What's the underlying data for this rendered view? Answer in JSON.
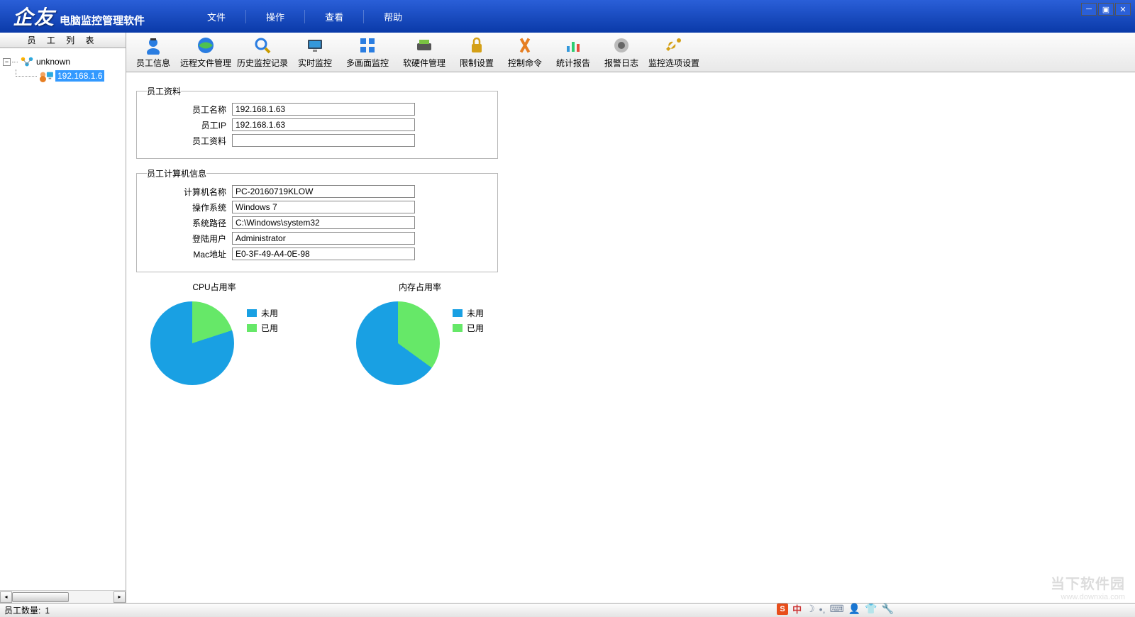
{
  "app": {
    "logo": "企友",
    "subtitle": "电脑监控管理软件"
  },
  "menu": [
    "文件",
    "操作",
    "查看",
    "帮助"
  ],
  "sidebar": {
    "title": "员 工 列 表",
    "root": "unknown",
    "child": "192.168.1.6"
  },
  "toolbar": [
    {
      "label": "员工信息"
    },
    {
      "label": "远程文件管理"
    },
    {
      "label": "历史监控记录"
    },
    {
      "label": "实时监控"
    },
    {
      "label": "多画面监控"
    },
    {
      "label": "软硬件管理"
    },
    {
      "label": "限制设置"
    },
    {
      "label": "控制命令"
    },
    {
      "label": "统计报告"
    },
    {
      "label": "报警日志"
    },
    {
      "label": "监控选项设置"
    }
  ],
  "group1": {
    "legend": "员工资料",
    "rows": [
      {
        "label": "员工名称",
        "value": "192.168.1.63"
      },
      {
        "label": "员工IP",
        "value": "192.168.1.63"
      },
      {
        "label": "员工资料",
        "value": ""
      }
    ]
  },
  "group2": {
    "legend": "员工计算机信息",
    "rows": [
      {
        "label": "计算机名称",
        "value": "PC-20160719KLOW"
      },
      {
        "label": "操作系统",
        "value": "Windows 7"
      },
      {
        "label": "系统路径",
        "value": "C:\\Windows\\system32"
      },
      {
        "label": "登陆用户",
        "value": "Administrator"
      },
      {
        "label": "Mac地址",
        "value": "E0-3F-49-A4-0E-98"
      }
    ]
  },
  "chart_data": [
    {
      "type": "pie",
      "title": "CPU占用率",
      "series": [
        {
          "name": "未用",
          "value": 80,
          "color": "#19a0e3"
        },
        {
          "name": "已用",
          "value": 20,
          "color": "#66e868"
        }
      ]
    },
    {
      "type": "pie",
      "title": "内存占用率",
      "series": [
        {
          "name": "未用",
          "value": 65,
          "color": "#19a0e3"
        },
        {
          "name": "已用",
          "value": 35,
          "color": "#66e868"
        }
      ]
    }
  ],
  "status": {
    "label": "员工数量:",
    "count": "1"
  },
  "watermark": {
    "line1": "当下软件园",
    "line2": "www.downxia.com"
  },
  "ime": {
    "lang": "中"
  }
}
